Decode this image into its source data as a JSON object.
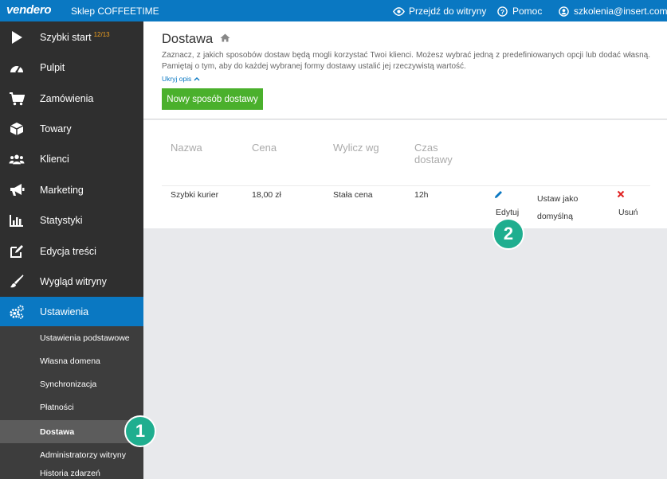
{
  "topbar": {
    "logo": "vendero",
    "shop_name": "Sklep COFFEETIME",
    "goto_site": "Przejdź do witryny",
    "help": "Pomoc",
    "user": "szkolenia@insert.com.pl"
  },
  "sidebar": {
    "items": [
      {
        "label": "Szybki start",
        "badge": "12/13",
        "icon": "play-icon"
      },
      {
        "label": "Pulpit",
        "icon": "dashboard-icon"
      },
      {
        "label": "Zamówienia",
        "icon": "cart-icon"
      },
      {
        "label": "Towary",
        "icon": "box-icon"
      },
      {
        "label": "Klienci",
        "icon": "users-icon"
      },
      {
        "label": "Marketing",
        "icon": "megaphone-icon"
      },
      {
        "label": "Statystyki",
        "icon": "bar-chart-icon"
      },
      {
        "label": "Edycja treści",
        "icon": "edit-icon"
      },
      {
        "label": "Wygląd witryny",
        "icon": "brush-icon"
      },
      {
        "label": "Ustawienia",
        "icon": "cogs-icon"
      }
    ],
    "sub_items": [
      "Ustawienia podstawowe",
      "Własna domena",
      "Synchronizacja",
      "Płatności",
      "Dostawa",
      "Administratorzy witryny",
      "Historia zdarzeń"
    ]
  },
  "header": {
    "title": "Dostawa",
    "description": "Zaznacz, z jakich sposobów dostaw będą mogli korzystać Twoi klienci. Możesz wybrać jedną z predefiniowanych opcji lub dodać własną. Pamiętaj o tym, aby do każdej wybranej formy dostawy ustalić jej rzeczywistą wartość.",
    "hide_link": "Ukryj opis",
    "new_button": "Nowy sposób dostawy"
  },
  "table": {
    "columns": [
      "Nazwa",
      "Cena",
      "Wylicz wg",
      "Czas dostawy"
    ],
    "rows": [
      {
        "name": "Szybki kurier",
        "price": "18,00 zł",
        "calc": "Stała cena",
        "time": "12h",
        "edit": "Edytuj",
        "set_default": "Ustaw jako domyślną",
        "delete": "Usuń"
      }
    ]
  },
  "markers": {
    "m1": "1",
    "m2": "2"
  },
  "colors": {
    "accent": "#0a78c2",
    "green": "#4ab02c",
    "marker": "#1fae8f",
    "danger": "#e02020"
  }
}
